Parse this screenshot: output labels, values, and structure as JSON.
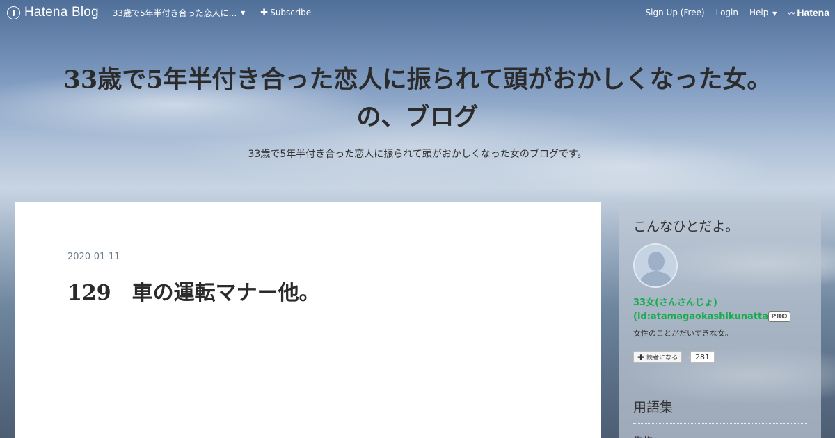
{
  "header": {
    "logo_text": "Hatena Blog",
    "blog_name": "33歳で5年半付き合った恋人に...",
    "subscribe_label": "Subscribe",
    "signup_label": "Sign Up (Free)",
    "login_label": "Login",
    "help_label": "Help",
    "hatena_label": "Hatena"
  },
  "blog": {
    "title_line1": "33歳で5年半付き合った恋人に振られて頭がおかしくなった女。",
    "title_line2": "の、ブログ",
    "description": "33歳で5年半付き合った恋人に振られて頭がおかしくなった女のブログです。"
  },
  "entry": {
    "date": "2020-01-11",
    "title": "129　車の運転マナー他。"
  },
  "sidebar": {
    "profile_heading": "こんなひとだよ。",
    "profile_name": "33女(さんさんじょ)",
    "profile_id": "(id:atamagaokashikunatta)",
    "pro_badge": "PRO",
    "profile_description": "女性のことがだいすきな女。",
    "subscribe_label": "読者になる",
    "reader_count": "281",
    "glossary_heading": "用語集",
    "glossary_first_item": "生物"
  },
  "colors": {
    "accent_green": "#1aab4e",
    "main_bg": "#ffffff",
    "header_text": "#ffffff"
  }
}
